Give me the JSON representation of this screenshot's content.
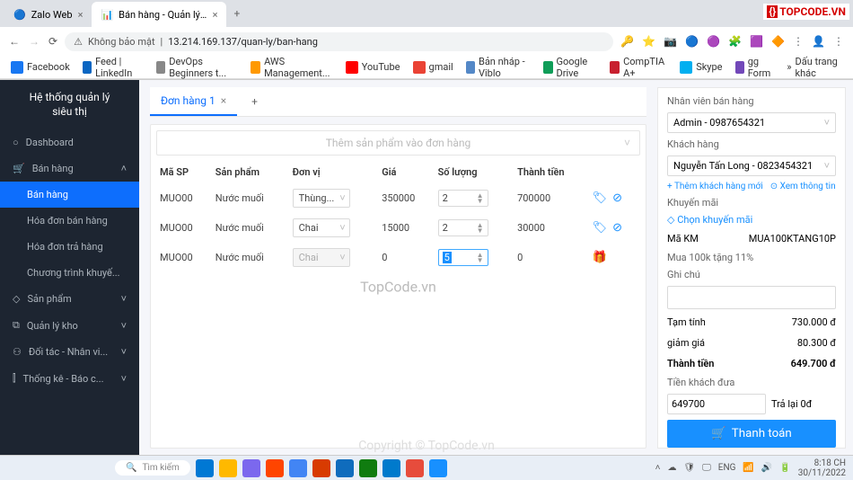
{
  "browser": {
    "tabs": [
      {
        "title": "Zalo Web",
        "active": false
      },
      {
        "title": "Bán hàng - Quản lý siêu thị mini",
        "active": true
      }
    ],
    "url_prefix": "Không bảo mật",
    "url": "13.214.169.137/quan-ly/ban-hang",
    "bookmarks": [
      "Facebook",
      "Feed | LinkedIn",
      "DevOps Beginners t...",
      "AWS Management...",
      "YouTube",
      "gmail",
      "Bản nháp - Viblo",
      "Google Drive",
      "CompTIA A+",
      "Skype",
      "gg Form"
    ],
    "bookmark_overflow": "Dấu trang khác"
  },
  "sidebar": {
    "title1": "Hệ thống quản lý",
    "title2": "siêu thị",
    "items": [
      {
        "icon": "○",
        "label": "Dashboard"
      },
      {
        "icon": "🛒",
        "label": "Bán hàng",
        "expand": "˄",
        "children": [
          {
            "label": "Bán hàng",
            "active": true
          },
          {
            "label": "Hóa đơn bán hàng"
          },
          {
            "label": "Hóa đơn trả hàng"
          },
          {
            "label": "Chương trình khuyế..."
          }
        ]
      },
      {
        "icon": "◇",
        "label": "Sản phẩm",
        "expand": "˅"
      },
      {
        "icon": "⧉",
        "label": "Quản lý kho",
        "expand": "˅"
      },
      {
        "icon": "⚇",
        "label": "Đối tác - Nhân vi...",
        "expand": "˅"
      },
      {
        "icon": "⫿",
        "label": "Thống kê - Báo c...",
        "expand": "˅"
      }
    ]
  },
  "orders": {
    "tab_label": "Đơn hàng 1",
    "add_product_placeholder": "Thêm sản phẩm vào đơn hàng",
    "columns": {
      "sku": "Mã SP",
      "product": "Sản phẩm",
      "unit": "Đơn vị",
      "price": "Giá",
      "qty": "Số lượng",
      "total": "Thành tiền"
    },
    "rows": [
      {
        "sku": "MUO00",
        "product": "Nước muối",
        "unit": "Thùng...",
        "price": "350000",
        "qty": "2",
        "total": "700000",
        "icons": "tag-stop"
      },
      {
        "sku": "MUO00",
        "product": "Nước muối",
        "unit": "Chai",
        "price": "15000",
        "qty": "2",
        "total": "30000",
        "icons": "tag-stop"
      },
      {
        "sku": "MUO00",
        "product": "Nước muối",
        "unit": "Chai",
        "unit_disabled": true,
        "price": "0",
        "qty": "5",
        "qty_selected": true,
        "total": "0",
        "icons": "gift"
      }
    ]
  },
  "panel": {
    "staff_label": "Nhân viên bán hàng",
    "staff_value": "Admin - 0987654321",
    "customer_label": "Khách hàng",
    "customer_value": "Nguyễn Tấn Long - 0823454321",
    "link_add_customer": "+ Thêm khách hàng mới",
    "link_view_info": "⊙ Xem thông tin",
    "promo_label": "Khuyến mãi",
    "link_promo": "◇ Chọn khuyến mãi",
    "promo_code_label": "Mã KM",
    "promo_code": "MUA100KTANG10P",
    "promo_desc": "Mua 100k tặng 11%",
    "note_label": "Ghi chú",
    "subtotal_label": "Tạm tính",
    "subtotal": "730.000 đ",
    "discount_label": "giảm giá",
    "discount": "80.300 đ",
    "total_label": "Thành tiền",
    "total": "649.700 đ",
    "cash_label": "Tiền khách đưa",
    "cash_value": "649700",
    "change_label": "Trả lại 0đ",
    "checkout": "Thanh toán"
  },
  "watermark": "TopCode.vn",
  "watermark_logo": "TOPCODE.VN",
  "copyright": "Copyright © TopCode.vn",
  "taskbar": {
    "search": "Tìm kiếm",
    "lang": "ENG",
    "time": "8:18 CH",
    "date": "30/11/2022"
  }
}
